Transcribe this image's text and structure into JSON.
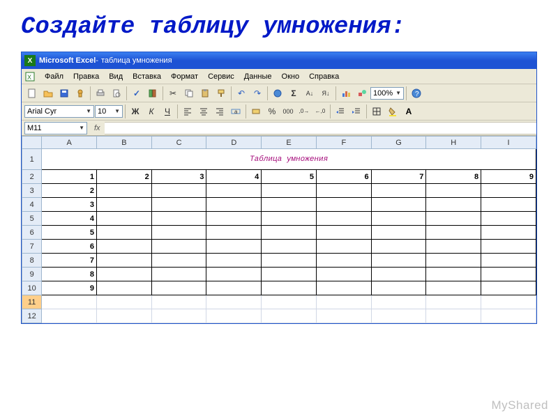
{
  "slide_title": "Создайте таблицу умножения:",
  "titlebar": {
    "app": "Microsoft Excel",
    "doc": "таблица умножения"
  },
  "menus": [
    "Файл",
    "Правка",
    "Вид",
    "Вставка",
    "Формат",
    "Сервис",
    "Данные",
    "Окно",
    "Справка"
  ],
  "toolbar1_icons": [
    "new",
    "open",
    "save",
    "permission",
    "print",
    "preview",
    "spelling",
    "research",
    "cut",
    "copy",
    "paste",
    "format-painter",
    "undo",
    "redo",
    "hyperlink",
    "autosum",
    "sort-asc",
    "sort-desc",
    "chart-wizard",
    "drawing"
  ],
  "zoom": "100%",
  "format_bar": {
    "font": "Arial Cyr",
    "size": "10",
    "buttons": [
      "bold",
      "italic",
      "underline",
      "align-left",
      "align-center",
      "align-right",
      "merge-center",
      "currency",
      "percent",
      "comma",
      "increase-decimal",
      "decrease-decimal",
      "decrease-indent",
      "increase-indent",
      "borders",
      "fill-color",
      "font-color"
    ]
  },
  "name_box": "M11",
  "fx_label": "fx",
  "columns": [
    "A",
    "B",
    "C",
    "D",
    "E",
    "F",
    "G",
    "H",
    "I"
  ],
  "rows": [
    "1",
    "2",
    "3",
    "4",
    "5",
    "6",
    "7",
    "8",
    "9",
    "10",
    "11",
    "12"
  ],
  "sheet_title": "Таблица умножения",
  "header_row": [
    "1",
    "2",
    "3",
    "4",
    "5",
    "6",
    "7",
    "8",
    "9"
  ],
  "first_col": [
    "2",
    "3",
    "4",
    "5",
    "6",
    "7",
    "8",
    "9"
  ],
  "selected_row": "11",
  "watermark": "MyShared"
}
